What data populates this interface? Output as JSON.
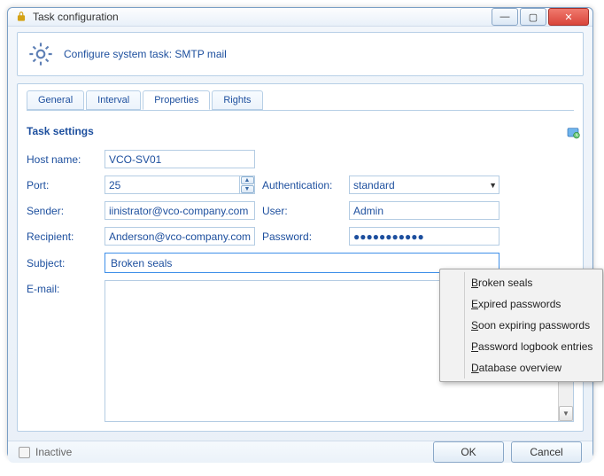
{
  "window": {
    "title": "Task configuration"
  },
  "header": {
    "text": "Configure system task: SMTP mail"
  },
  "tabs": {
    "items": [
      "General",
      "Interval",
      "Properties",
      "Rights"
    ],
    "active_index": 2
  },
  "section": {
    "title": "Task settings"
  },
  "form": {
    "host_label": "Host name:",
    "host_value": "VCO-SV01",
    "port_label": "Port:",
    "port_value": "25",
    "auth_label": "Authentication:",
    "auth_value": "standard",
    "sender_label": "Sender:",
    "sender_value": "iinistrator@vco-company.com",
    "user_label": "User:",
    "user_value": "Admin",
    "recipient_label": "Recipient:",
    "recipient_value": "Anderson@vco-company.com",
    "password_label": "Password:",
    "password_value": "●●●●●●●●●●●",
    "subject_label": "Subject:",
    "subject_value": "Broken seals",
    "email_label": "E-mail:",
    "email_value": ""
  },
  "context_menu": {
    "items": [
      {
        "label": "Broken seals",
        "accel": "B"
      },
      {
        "label": "Expired passwords",
        "accel": "E"
      },
      {
        "label": "Soon expiring passwords",
        "accel": "S"
      },
      {
        "label": "Password logbook entries",
        "accel": "P"
      },
      {
        "label": "Database overview",
        "accel": "D"
      }
    ]
  },
  "footer": {
    "inactive_label": "Inactive",
    "ok": "OK",
    "cancel": "Cancel"
  }
}
